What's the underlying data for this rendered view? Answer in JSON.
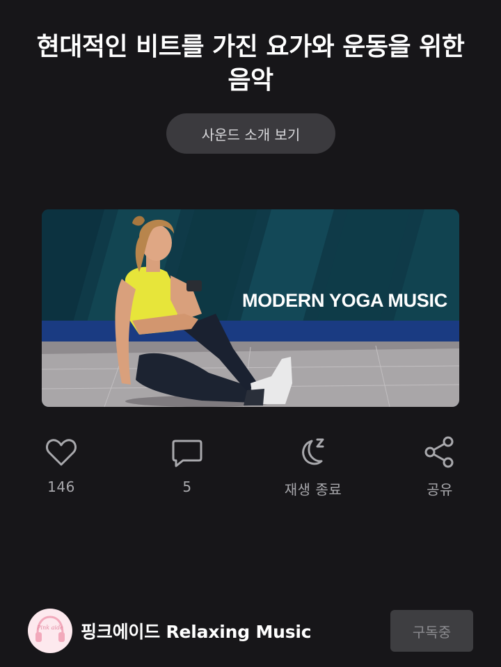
{
  "title": "현대적인 비트를 가진 요가와 운동을 위한 음악",
  "intro_button": "사운드 소개 보기",
  "banner": {
    "text": "MODERN YOGA MUSIC"
  },
  "actions": {
    "like": {
      "icon": "heart-icon",
      "label": "146"
    },
    "comment": {
      "icon": "comment-icon",
      "label": "5"
    },
    "sleep_timer": {
      "icon": "moon-zzz-icon",
      "label": "재생 종료"
    },
    "share": {
      "icon": "share-icon",
      "label": "공유"
    }
  },
  "channel": {
    "name": "핑크에이드 Relaxing Music",
    "logo_text": "Pink aide"
  },
  "subscribe_button": "구독중",
  "colors": {
    "background": "#171619",
    "icon_gray": "#a9a9ad",
    "button_bg": "#3b3a3e",
    "banner_teal": "#0e3a46"
  }
}
